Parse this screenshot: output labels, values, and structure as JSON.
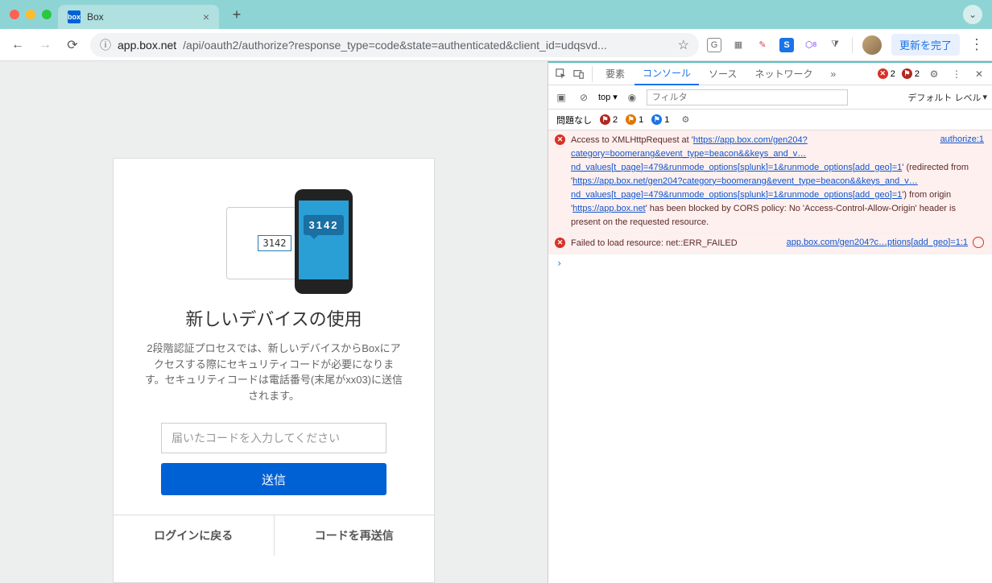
{
  "browser": {
    "tab": {
      "title": "Box",
      "favicon_text": "box"
    },
    "url": {
      "host": "app.box.net",
      "path": "/api/oauth2/authorize?response_type=code&state=authenticated&client_id=udqsvd..."
    },
    "update_label": "更新を完了"
  },
  "page": {
    "illustration_code": "3142",
    "phone_code": "3142",
    "title": "新しいデバイスの使用",
    "description": "2段階認証プロセスでは、新しいデバイスからBoxにアクセスする際にセキュリティコードが必要になります。セキュリティコードは電話番号(末尾がxx03)に送信されます。",
    "code_placeholder": "届いたコードを入力してください",
    "submit_label": "送信",
    "back_label": "ログインに戻る",
    "resend_label": "コードを再送信"
  },
  "devtools": {
    "tabs": {
      "elements": "要素",
      "console": "コンソール",
      "sources": "ソース",
      "network": "ネットワーク",
      "more": "»"
    },
    "error_count": "2",
    "issue_count": "2",
    "filter": {
      "top_label": "top",
      "placeholder": "フィルタ",
      "level_label": "デフォルト レベル"
    },
    "issues": {
      "no_issues": "問題なし",
      "flag_red": "2",
      "flag_orange": "1",
      "flag_blue": "1"
    },
    "messages": {
      "cors": {
        "src": "authorize:1",
        "t1": "Access to XMLHttpRequest at '",
        "l1": "https://app.box.com/gen204?category=boomerang&event_type=beacon&&keys_and_v…nd_values[t_page]=479&runmode_options[splunk]=1&runmode_options[add_geo]=1",
        "t2": "' (redirected from '",
        "l2": "https://app.box.net/gen204?category=boomerang&event_type=beacon&&keys_and_v…nd_values[t_page]=479&runmode_options[splunk]=1&runmode_options[add_geo]=1",
        "t3": "') from origin '",
        "l3": "https://app.box.net",
        "t4": "' has been blocked by CORS policy: No 'Access-Control-Allow-Origin' header is present on the requested resource."
      },
      "failed": {
        "text": "Failed to load resource: net::ERR_FAILED",
        "src": "app.box.com/gen204?c…ptions[add_geo]=1:1"
      }
    },
    "prompt": "›"
  }
}
